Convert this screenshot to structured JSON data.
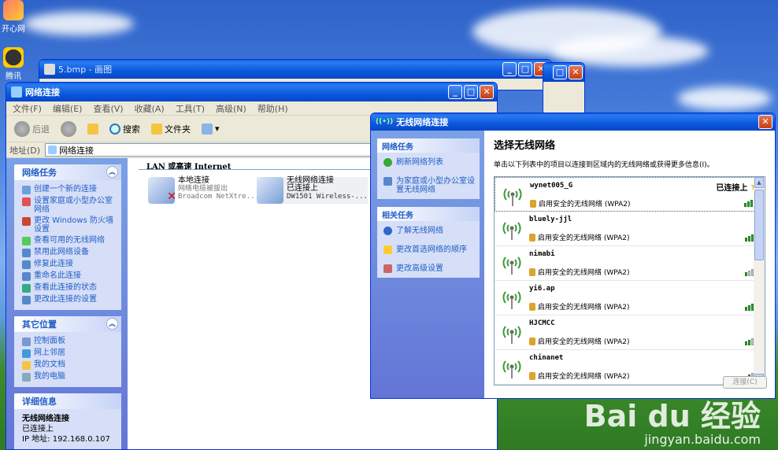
{
  "desktop": {
    "icon1_label": "开心网",
    "icon2_label": "腾讯QQ"
  },
  "paint_window": {
    "title": "5.bmp - 画图"
  },
  "net_window": {
    "title": "网络连接",
    "menu": [
      "文件(F)",
      "编辑(E)",
      "查看(V)",
      "收藏(A)",
      "工具(T)",
      "高级(N)",
      "帮助(H)"
    ],
    "toolbar": {
      "back": "后退",
      "search": "搜索",
      "folders": "文件夹"
    },
    "address_label": "地址(D)",
    "address_value": "网络连接",
    "network_tasks": {
      "title": "网络任务",
      "items": [
        "创建一个新的连接",
        "设置家庭或小型办公室网络",
        "更改 Windows 防火墙设置",
        "查看可用的无线网络",
        "禁用此网络设备",
        "修复此连接",
        "重命名此连接",
        "查看此连接的状态",
        "更改此连接的设置"
      ]
    },
    "other_places": {
      "title": "其它位置",
      "items": [
        "控制面板",
        "网上邻居",
        "我的文档",
        "我的电脑"
      ]
    },
    "details": {
      "title": "详细信息",
      "name": "无线网络连接",
      "status": "已连接上",
      "ip": "IP 地址: 192.168.0.107"
    },
    "group_header": "LAN 或高速 Internet",
    "connections": [
      {
        "name": "本地连接",
        "status": "网络电缆被拔出",
        "device": "Broadcom NetXtre..."
      },
      {
        "name": "无线网络连接",
        "status": "已连接上",
        "device": "DW1501 Wireless-..."
      }
    ]
  },
  "wifi_window": {
    "title": "无线网络连接",
    "tasks_title": "网络任务",
    "tasks": [
      "刷新网络列表",
      "为家庭或小型办公室设置无线网络"
    ],
    "related_title": "相关任务",
    "related": [
      "了解无线网络",
      "更改首选网络的顺序",
      "更改高级设置"
    ],
    "heading": "选择无线网络",
    "description": "单击以下列表中的项目以连接到区域内的无线网络或获得更多信息(I)。",
    "security": "启用安全的无线网络 (WPA2)",
    "connected_label": "已连接上",
    "networks": [
      {
        "ssid": "wynet005_G",
        "signal": 5,
        "connected": true
      },
      {
        "ssid": "bluely-jjl",
        "signal": 5,
        "connected": false
      },
      {
        "ssid": "nimabi",
        "signal": 1,
        "connected": false
      },
      {
        "ssid": "yi6.ap",
        "signal": 5,
        "connected": false
      },
      {
        "ssid": "HJCMCC",
        "signal": 2,
        "connected": false
      },
      {
        "ssid": "chinanet",
        "signal": 2,
        "connected": false
      }
    ],
    "connect_button": "连接(C)"
  },
  "watermark": {
    "logo": "Bai du 经验",
    "url": "jingyan.baidu.com"
  },
  "colors": {
    "xp_blue": "#0a58dc",
    "task_link": "#215dc6",
    "signal_on": "#2fa82f"
  }
}
